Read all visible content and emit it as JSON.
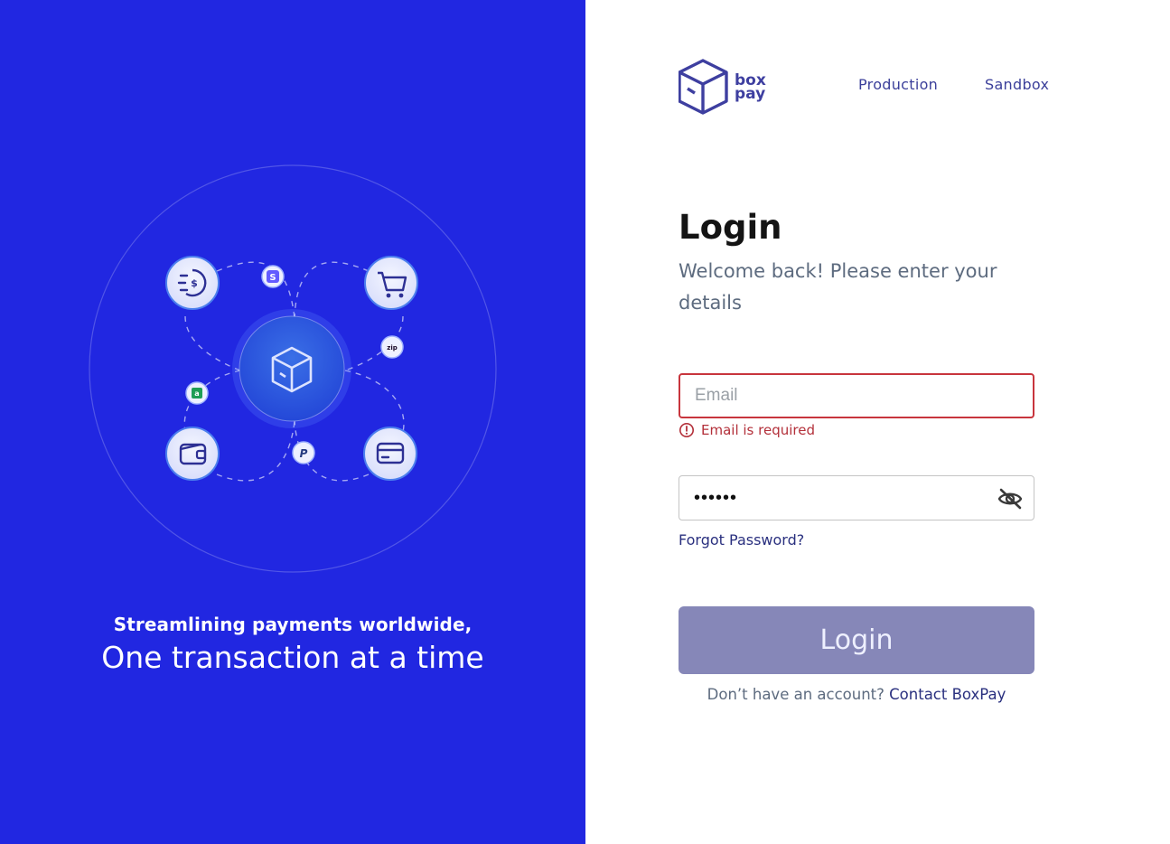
{
  "hero": {
    "tagline_line1": "Streamlining payments worldwide,",
    "tagline_line2": "One transaction at a time",
    "background_color": "#2127e1",
    "icons": [
      "dollar-coin-icon",
      "shopping-cart-icon",
      "wallet-icon",
      "credit-card-icon",
      "box-logo-icon",
      "stripe-badge-icon",
      "zip-badge-icon",
      "paypal-badge-icon",
      "afterpay-badge-icon"
    ]
  },
  "brand": {
    "line1": "box",
    "line2": "pay",
    "color": "#3e3fa0"
  },
  "nav": {
    "production": "Production",
    "sandbox": "Sandbox"
  },
  "login": {
    "title": "Login",
    "subtitle": "Welcome back! Please enter your details",
    "email_placeholder": "Email",
    "email_value": "",
    "email_error": "Email is required",
    "password_value": "••••••",
    "forgot": "Forgot Password?",
    "button": "Login",
    "signup_prompt": "Don’t have an account?",
    "signup_link": "Contact BoxPay"
  },
  "colors": {
    "error": "#c8353d",
    "button_disabled": "#8687b8",
    "link": "#2a307f"
  }
}
